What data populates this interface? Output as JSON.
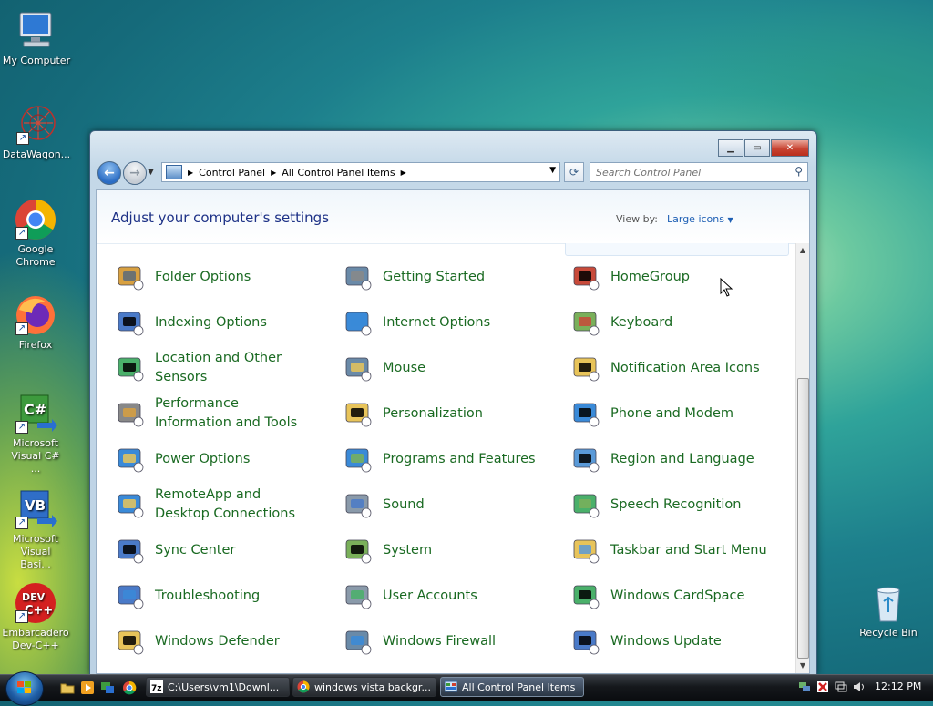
{
  "desktop": {
    "icons": [
      {
        "label": "My Computer"
      },
      {
        "label": "DataWagon..."
      },
      {
        "label": "Google Chrome"
      },
      {
        "label": "Firefox"
      },
      {
        "label": "Microsoft Visual C# ..."
      },
      {
        "label": "Microsoft Visual Basi..."
      },
      {
        "label": "Embarcadero Dev-C++"
      },
      {
        "label": "Recycle Bin"
      }
    ]
  },
  "window": {
    "breadcrumb": [
      "Control Panel",
      "All Control Panel Items"
    ],
    "search_placeholder": "Search Control Panel",
    "heading": "Adjust your computer's settings",
    "view_by_label": "View by:",
    "view_by_value": "Large icons",
    "items": [
      [
        "Folder Options",
        "Getting Started",
        "HomeGroup"
      ],
      [
        "Indexing Options",
        "Internet Options",
        "Keyboard"
      ],
      [
        "Location and Other Sensors",
        "Mouse",
        "Notification Area Icons"
      ],
      [
        "Performance Information and Tools",
        "Personalization",
        "Phone and Modem"
      ],
      [
        "Power Options",
        "Programs and Features",
        "Region and Language"
      ],
      [
        "RemoteApp and Desktop Connections",
        "Sound",
        "Speech Recognition"
      ],
      [
        "Sync Center",
        "System",
        "Taskbar and Start Menu"
      ],
      [
        "Troubleshooting",
        "User Accounts",
        "Windows CardSpace"
      ],
      [
        "Windows Defender",
        "Windows Firewall",
        "Windows Update"
      ]
    ]
  },
  "taskbar": {
    "tasks": [
      {
        "label": "C:\\Users\\vm1\\Downl..."
      },
      {
        "label": "windows vista backgr..."
      },
      {
        "label": "All Control Panel Items"
      }
    ],
    "clock": "12:12 PM"
  },
  "colors": {
    "link_green": "#1a6a22",
    "heading_blue": "#1e3287",
    "close_red": "#c84432"
  }
}
